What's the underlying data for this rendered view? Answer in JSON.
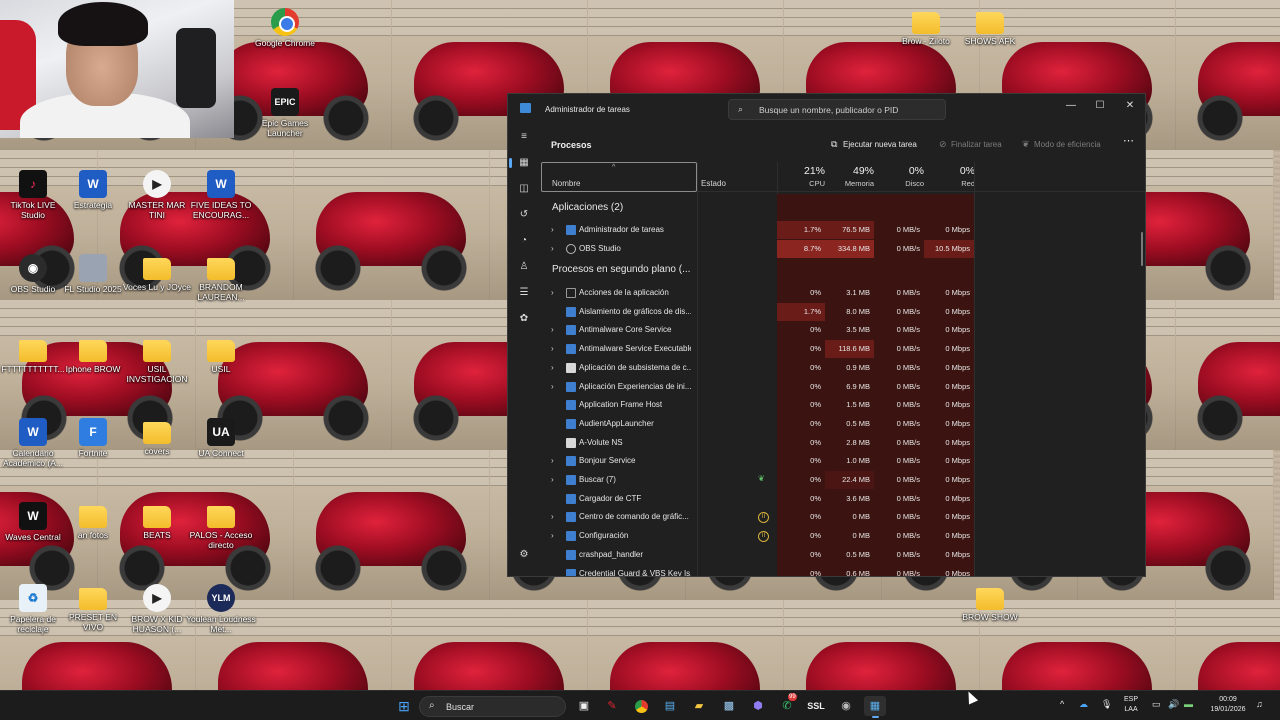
{
  "desktop": {
    "icons": [
      {
        "label": "Google Chrome",
        "glyph": "",
        "icon": "chrome-icon",
        "kind": "chrome"
      },
      {
        "label": "Brow - Ziloto",
        "glyph": "",
        "icon": "folder-icon",
        "kind": "folder"
      },
      {
        "label": "SHOWS AFK",
        "glyph": "",
        "icon": "folder-icon",
        "kind": "folder"
      },
      {
        "label": "Epic Games Launcher",
        "glyph": "EPIC",
        "icon": "epic-games-icon",
        "kind": "epic"
      },
      {
        "label": "TikTok LIVE Studio",
        "glyph": "♪",
        "icon": "tiktok-icon",
        "kind": "tiktok"
      },
      {
        "label": "Estrategia",
        "glyph": "W",
        "icon": "word-icon",
        "kind": "word"
      },
      {
        "label": "MASTER MAR TINI",
        "glyph": "▶",
        "icon": "media-icon",
        "kind": "media"
      },
      {
        "label": "FIVE IDEAS TO ENCOURAG...",
        "glyph": "W",
        "icon": "word-icon",
        "kind": "word"
      },
      {
        "label": "OBS Studio",
        "glyph": "◉",
        "icon": "obs-icon",
        "kind": "obs"
      },
      {
        "label": "FL Studio 2025",
        "glyph": "",
        "icon": "file-icon",
        "kind": "gen"
      },
      {
        "label": "Voces Lu y JOyce",
        "glyph": "",
        "icon": "folder-icon",
        "kind": "folder"
      },
      {
        "label": "BRANDOM LAUREAN...",
        "glyph": "",
        "icon": "folder-icon",
        "kind": "folder"
      },
      {
        "label": "FTTTTTTTTTT...",
        "glyph": "",
        "icon": "folder-icon",
        "kind": "folder"
      },
      {
        "label": "Iphone BROW",
        "glyph": "",
        "icon": "folder-icon",
        "kind": "folder"
      },
      {
        "label": "USIL INVSTIGACION",
        "glyph": "",
        "icon": "folder-icon",
        "kind": "folder"
      },
      {
        "label": "USIL",
        "glyph": "",
        "icon": "folder-icon",
        "kind": "folder"
      },
      {
        "label": "Calendario Academico (A...",
        "glyph": "W",
        "icon": "word-icon",
        "kind": "word"
      },
      {
        "label": "Fortnite",
        "glyph": "F",
        "icon": "fortnite-icon",
        "kind": "blue"
      },
      {
        "label": "covers",
        "glyph": "",
        "icon": "folder-icon",
        "kind": "folder"
      },
      {
        "label": "UA Connect",
        "glyph": "UA",
        "icon": "ua-connect-icon",
        "kind": "ua"
      },
      {
        "label": "Waves Central",
        "glyph": "W",
        "icon": "waves-icon",
        "kind": "waves"
      },
      {
        "label": "an fotos",
        "glyph": "",
        "icon": "folder-icon",
        "kind": "folder"
      },
      {
        "label": "BEATS",
        "glyph": "",
        "icon": "folder-icon",
        "kind": "folder"
      },
      {
        "label": "PALOS - Acceso directo",
        "glyph": "",
        "icon": "folder-shortcut-icon",
        "kind": "folder"
      },
      {
        "label": "Papelera de reciclaje",
        "glyph": "♻",
        "icon": "recycle-bin-icon",
        "kind": "recycle"
      },
      {
        "label": "PRESET EN VIVO",
        "glyph": "",
        "icon": "folder-icon",
        "kind": "folder"
      },
      {
        "label": "BROW X KID HUASON (...",
        "glyph": "▶",
        "icon": "media-icon",
        "kind": "media"
      },
      {
        "label": "Youlean Loudness Met...",
        "glyph": "YLM",
        "icon": "youlean-icon",
        "kind": "ylm"
      },
      {
        "label": "BROW SHOW",
        "glyph": "",
        "icon": "folder-icon",
        "kind": "folder"
      }
    ]
  },
  "taskmgr": {
    "title": "Administrador de tareas",
    "search_placeholder": "Busque un nombre, publicador o PID",
    "page_title": "Procesos",
    "toolbar": {
      "run_task": "Ejecutar nueva tarea",
      "end_task": "Finalizar tarea",
      "efficiency": "Modo de eficiencia"
    },
    "columns": {
      "name": "Nombre",
      "status": "Estado",
      "cpu": {
        "pct": "21%",
        "label": "CPU"
      },
      "memory": {
        "pct": "49%",
        "label": "Memoria"
      },
      "disk": {
        "pct": "0%",
        "label": "Disco"
      },
      "network": {
        "pct": "0%",
        "label": "Red"
      }
    },
    "groups": {
      "apps": "Aplicaciones (2)",
      "background": "Procesos en segundo plano (..."
    },
    "apps": [
      {
        "name": "Administrador de tareas",
        "cpu": "1.7%",
        "mem": "76.5 MB",
        "disk": "0 MB/s",
        "net": "0 Mbps",
        "expandable": true,
        "icon": "task-manager-icon"
      },
      {
        "name": "OBS Studio",
        "cpu": "8.7%",
        "mem": "334.8 MB",
        "disk": "0 MB/s",
        "net": "10.5 Mbps",
        "expandable": true,
        "icon": "obs-icon"
      }
    ],
    "background": [
      {
        "name": "Acciones de la aplicación",
        "cpu": "0%",
        "mem": "3.1 MB",
        "disk": "0 MB/s",
        "net": "0 Mbps",
        "expandable": true,
        "icon": "process-icon",
        "status": ""
      },
      {
        "name": "Aislamiento de gráficos de dis...",
        "cpu": "1.7%",
        "mem": "8.0 MB",
        "disk": "0 MB/s",
        "net": "0 Mbps",
        "expandable": false,
        "icon": "process-icon",
        "status": ""
      },
      {
        "name": "Antimalware Core Service",
        "cpu": "0%",
        "mem": "3.5 MB",
        "disk": "0 MB/s",
        "net": "0 Mbps",
        "expandable": true,
        "icon": "process-icon",
        "status": ""
      },
      {
        "name": "Antimalware Service Executable",
        "cpu": "0%",
        "mem": "118.6 MB",
        "disk": "0 MB/s",
        "net": "0 Mbps",
        "expandable": true,
        "icon": "process-icon",
        "status": ""
      },
      {
        "name": "Aplicación de subsistema de c...",
        "cpu": "0%",
        "mem": "0.9 MB",
        "disk": "0 MB/s",
        "net": "0 Mbps",
        "expandable": true,
        "icon": "printer-icon",
        "status": ""
      },
      {
        "name": "Aplicación Experiencias de ini...",
        "cpu": "0%",
        "mem": "6.9 MB",
        "disk": "0 MB/s",
        "net": "0 Mbps",
        "expandable": true,
        "icon": "process-icon",
        "status": ""
      },
      {
        "name": "Application Frame Host",
        "cpu": "0%",
        "mem": "1.5 MB",
        "disk": "0 MB/s",
        "net": "0 Mbps",
        "expandable": false,
        "icon": "process-icon",
        "status": ""
      },
      {
        "name": "AudientAppLauncher",
        "cpu": "0%",
        "mem": "0.5 MB",
        "disk": "0 MB/s",
        "net": "0 Mbps",
        "expandable": false,
        "icon": "process-icon",
        "status": ""
      },
      {
        "name": "A-Volute NS",
        "cpu": "0%",
        "mem": "2.8 MB",
        "disk": "0 MB/s",
        "net": "0 Mbps",
        "expandable": false,
        "icon": "avolute-icon",
        "status": ""
      },
      {
        "name": "Bonjour Service",
        "cpu": "0%",
        "mem": "1.0 MB",
        "disk": "0 MB/s",
        "net": "0 Mbps",
        "expandable": true,
        "icon": "process-icon",
        "status": ""
      },
      {
        "name": "Buscar (7)",
        "cpu": "0%",
        "mem": "22.4 MB",
        "disk": "0 MB/s",
        "net": "0 Mbps",
        "expandable": true,
        "icon": "search-process-icon",
        "status": "leaf"
      },
      {
        "name": "Cargador de CTF",
        "cpu": "0%",
        "mem": "3.6 MB",
        "disk": "0 MB/s",
        "net": "0 Mbps",
        "expandable": false,
        "icon": "process-icon",
        "status": ""
      },
      {
        "name": "Centro de comando de gráfic...",
        "cpu": "0%",
        "mem": "0 MB",
        "disk": "0 MB/s",
        "net": "0 Mbps",
        "expandable": true,
        "icon": "process-icon",
        "status": "pause"
      },
      {
        "name": "Configuración",
        "cpu": "0%",
        "mem": "0 MB",
        "disk": "0 MB/s",
        "net": "0 Mbps",
        "expandable": true,
        "icon": "settings-icon",
        "status": "pause"
      },
      {
        "name": "crashpad_handler",
        "cpu": "0%",
        "mem": "0.5 MB",
        "disk": "0 MB/s",
        "net": "0 Mbps",
        "expandable": false,
        "icon": "process-icon",
        "status": ""
      },
      {
        "name": "Credential Guard & VBS Key Is...",
        "cpu": "0%",
        "mem": "0.6 MB",
        "disk": "0 MB/s",
        "net": "0 Mbps",
        "expandable": false,
        "icon": "process-icon",
        "status": ""
      }
    ]
  },
  "taskbar": {
    "search_placeholder": "Buscar",
    "ssl_label": "SSL",
    "whatsapp_badge": "99",
    "lang_line1": "ESP",
    "lang_line2": "LAA",
    "time": "00:09",
    "date": "19/01/2026"
  },
  "colors": {
    "accent": "#60a8f0",
    "heat_low": "#3b1310",
    "heat_mid": "#6a1d18",
    "heat_high": "#8a2520"
  }
}
